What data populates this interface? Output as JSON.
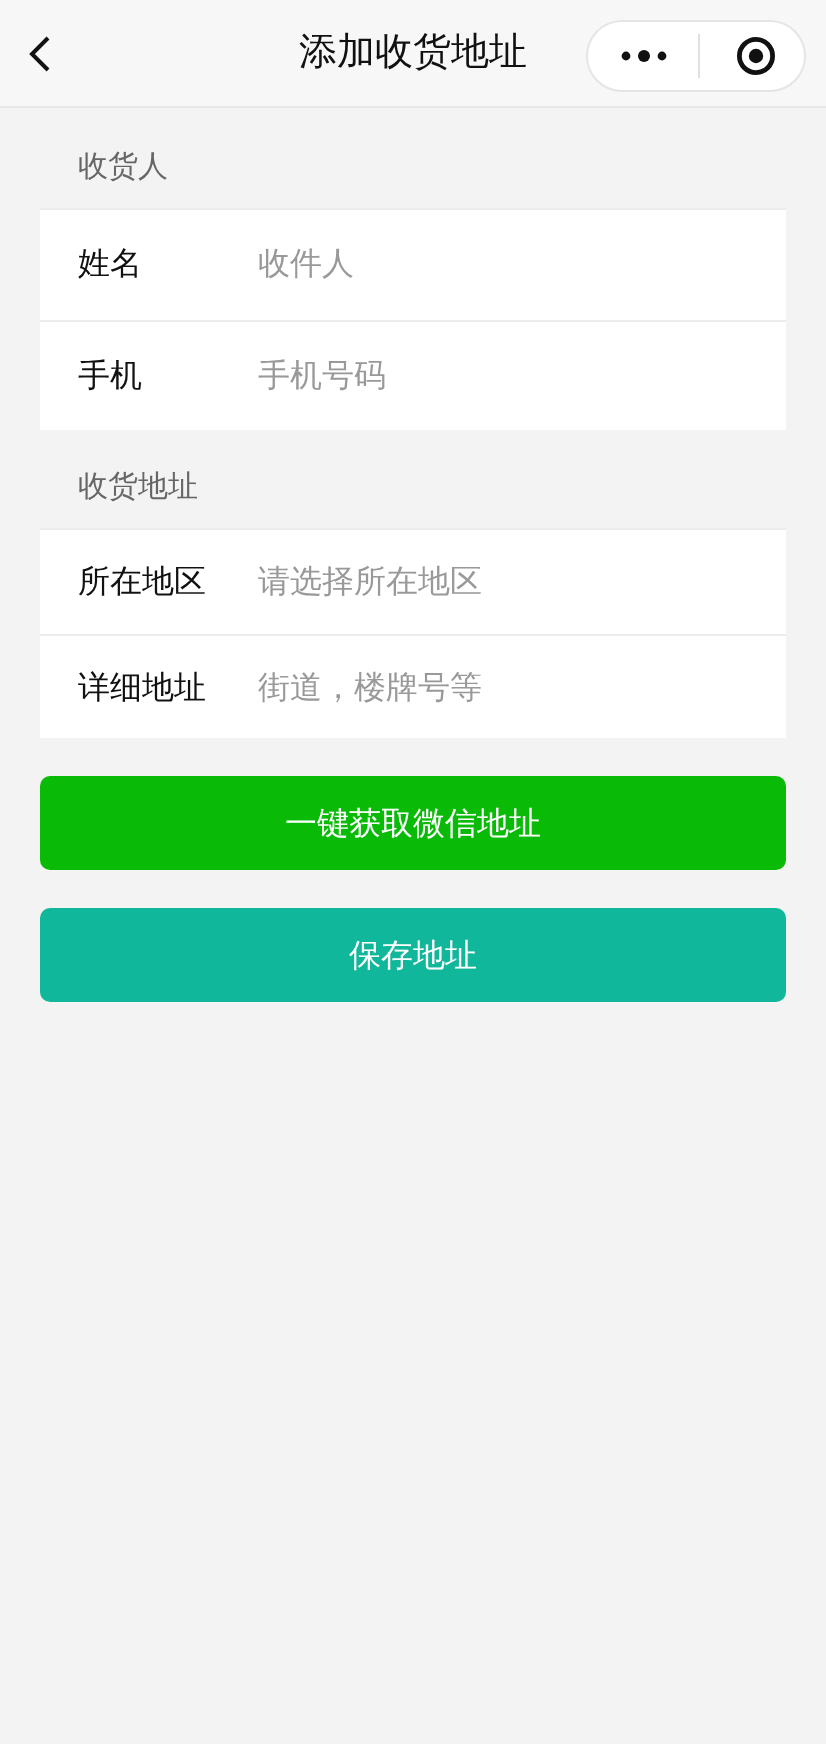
{
  "nav_bar": {
    "title": "添加收货地址"
  },
  "sections": [
    {
      "title": "收货人",
      "fields": [
        {
          "label": "姓名",
          "placeholder": "收件人"
        },
        {
          "label": "手机",
          "placeholder": "手机号码"
        }
      ]
    },
    {
      "title": "收货地址",
      "fields": [
        {
          "label": "所在地区",
          "placeholder": "请选择所在地区"
        },
        {
          "label": "详细地址",
          "placeholder": "街道，楼牌号等"
        }
      ]
    }
  ],
  "buttons": [
    {
      "label": "一键获取微信地址",
      "kind": "wechat"
    },
    {
      "label": "保存地址",
      "kind": "save"
    }
  ]
}
